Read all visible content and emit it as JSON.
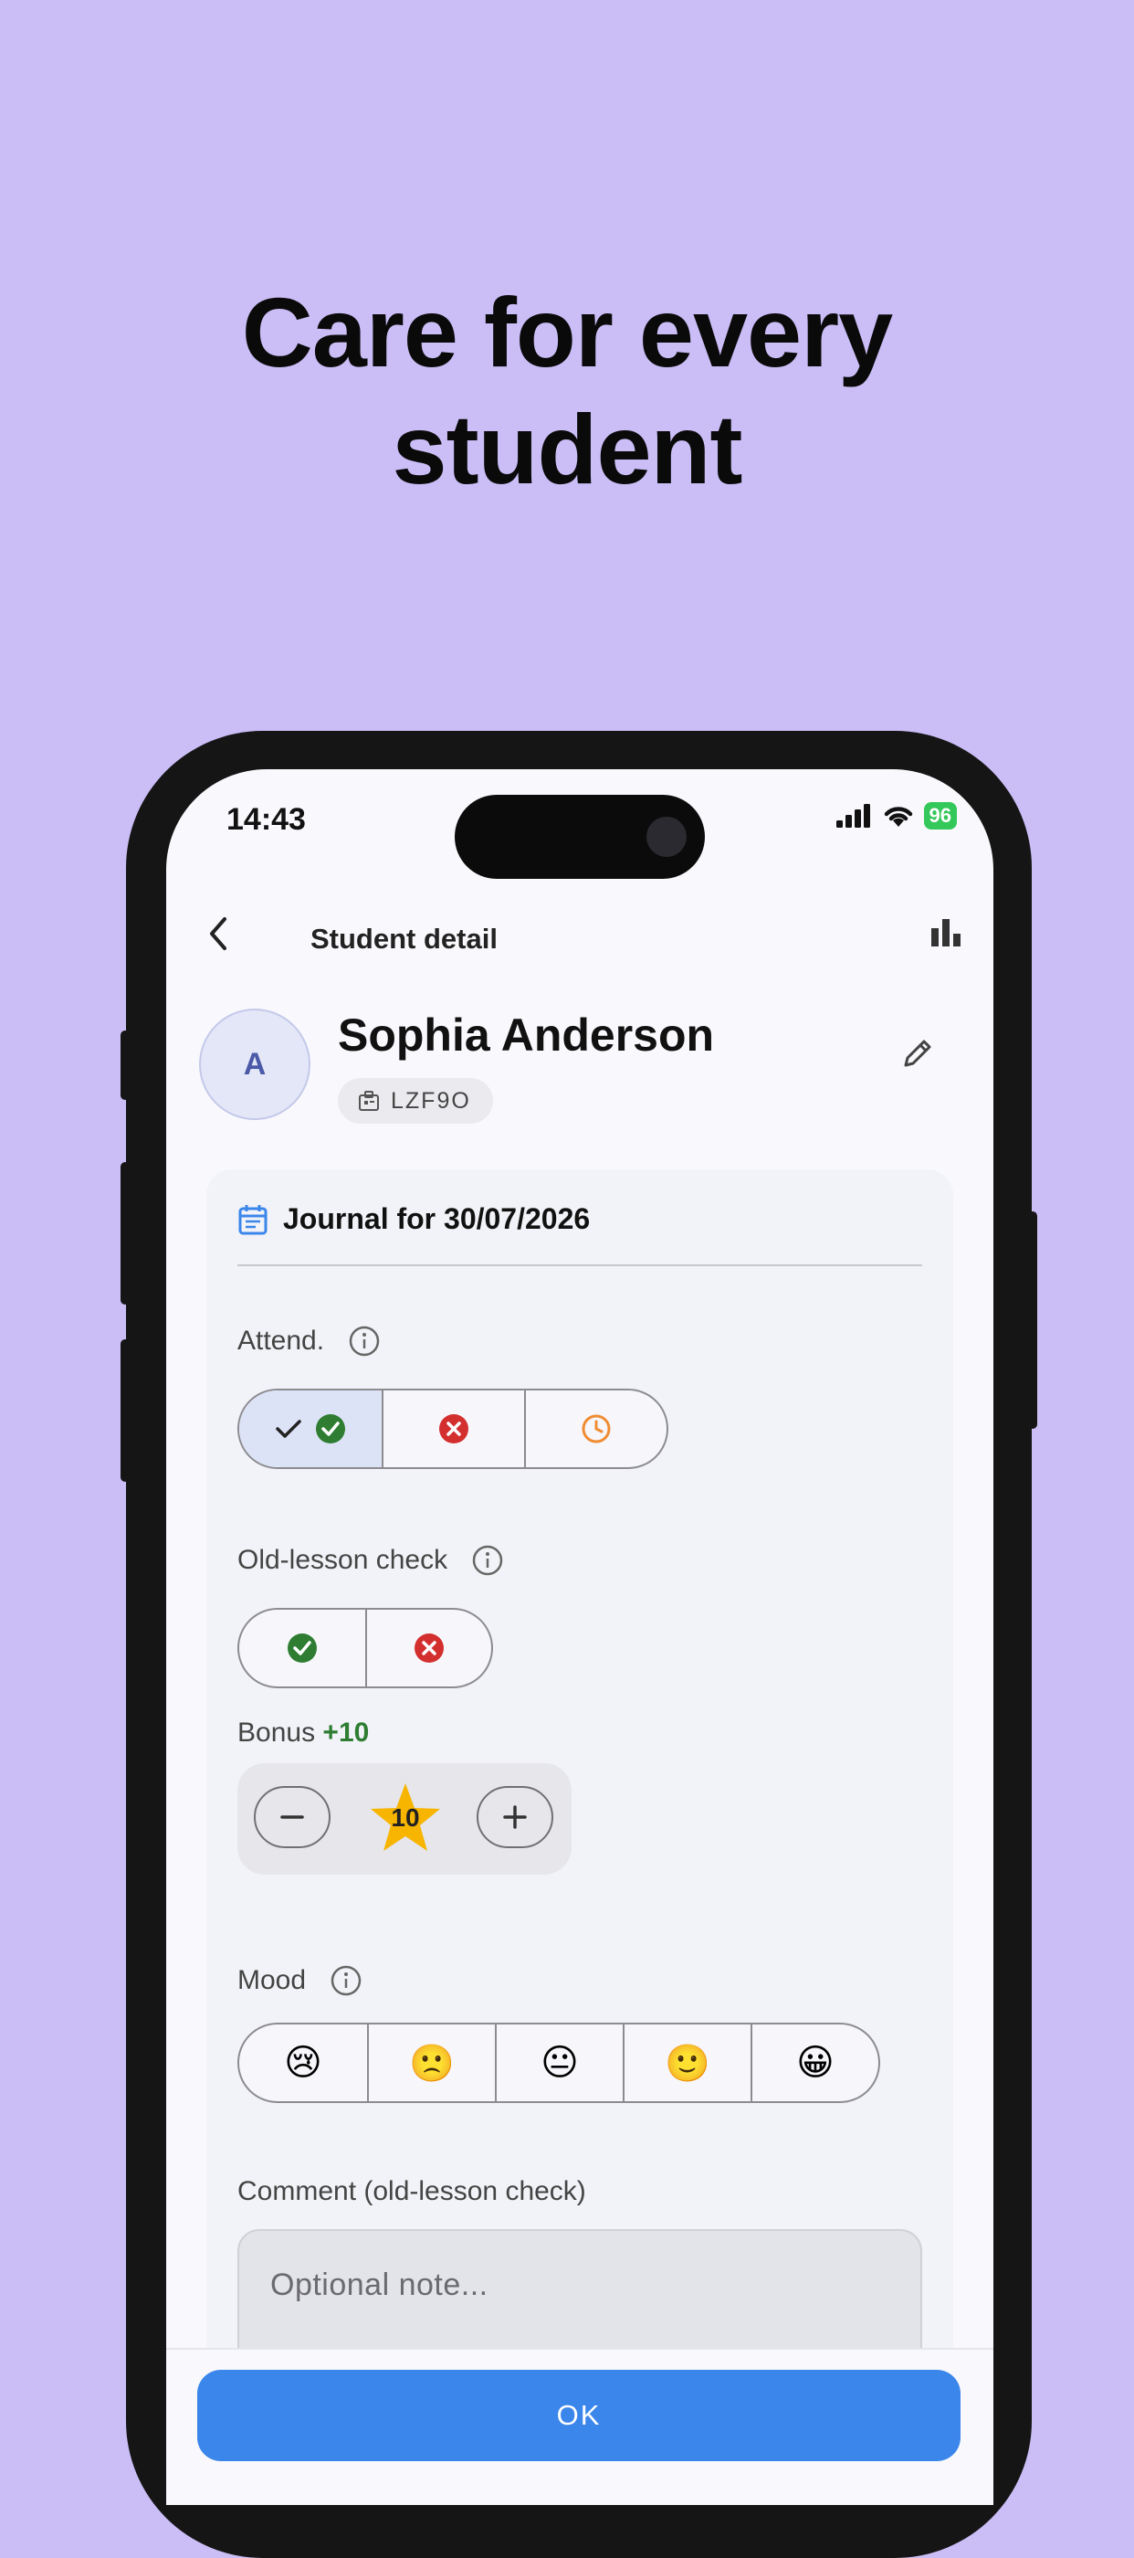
{
  "headline": {
    "line1": "Care for every",
    "line2": "student"
  },
  "status_bar": {
    "time": "14:43",
    "battery": "96"
  },
  "topbar": {
    "title": "Student detail"
  },
  "student": {
    "initial": "A",
    "name": "Sophia Anderson",
    "code": "LZF9O"
  },
  "journal": {
    "title": "Journal for 30/07/2026"
  },
  "attendance": {
    "label": "Attend.",
    "selected": "present"
  },
  "old_lesson": {
    "label": "Old-lesson check"
  },
  "bonus": {
    "label": "Bonus",
    "value_text": "+10",
    "count": "10"
  },
  "mood": {
    "label": "Mood",
    "options": [
      "😢",
      "🙁",
      "😐",
      "🙂",
      "😀"
    ]
  },
  "comment": {
    "label": "Comment (old-lesson check)",
    "placeholder": "Optional note..."
  },
  "actions": {
    "ok_label": "OK"
  },
  "colors": {
    "background": "#cbbef7",
    "accent": "#3b86ea",
    "success": "#2e7d32",
    "error": "#d32f2f",
    "late": "#f08c32",
    "star": "#f7b500"
  }
}
